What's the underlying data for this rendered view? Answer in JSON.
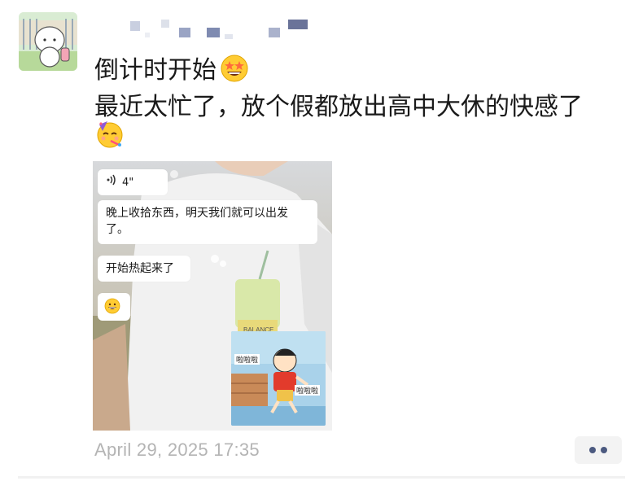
{
  "post": {
    "line1": "倒计时开始",
    "line2": "最近太忙了，放个假都放出高中大休的快感了",
    "emoji1": "star-struck-emoji",
    "emoji2": "partying-face-emoji",
    "timestamp": "April 29, 2025 17:35"
  },
  "image": {
    "voice_duration": "4\"",
    "message_1": "晚上收拾东西，明天我们就可以出发了。",
    "message_2": "开始热起来了",
    "message_3": "grinning-emoji",
    "sticker_text_1": "啦啦啦",
    "sticker_text_2": "啦啦啦",
    "sticker_cup_text": "BALANCE"
  },
  "icons": {
    "voice": "voice-wave-icon",
    "more": "more-dots-icon"
  },
  "colors": {
    "text": "#1a1a1a",
    "timestamp": "#b4b4b4",
    "more_dots": "#4c5a80",
    "more_bg": "#f3f3f3"
  }
}
